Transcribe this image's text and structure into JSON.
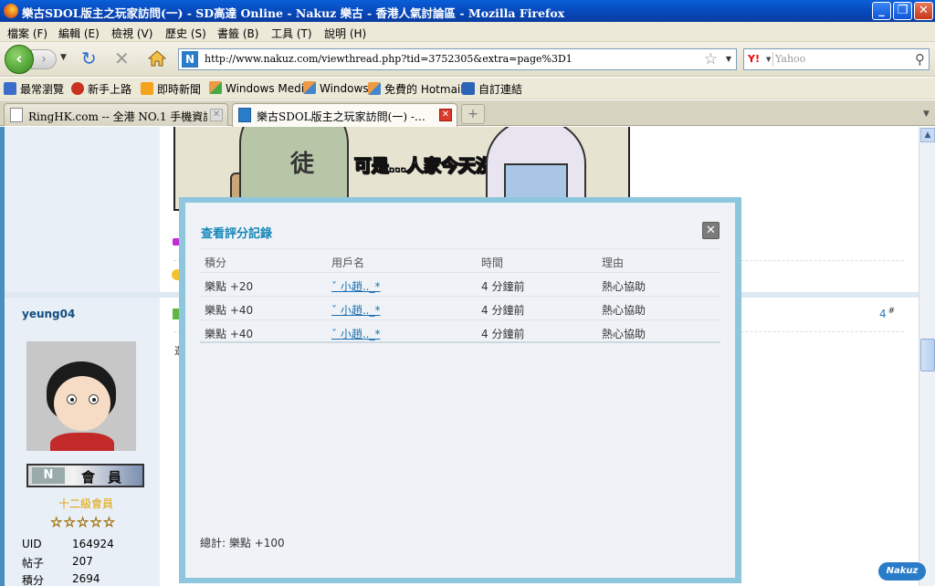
{
  "window": {
    "title": "樂古SDOL版主之玩家訪問(一) - SD高達 Online - Nakuz 樂古 - 香港人氣討論區 - Mozilla Firefox",
    "buttons": {
      "minimize": "_",
      "maximize": "❐",
      "close": "✕"
    }
  },
  "menu": [
    "檔案 (F)",
    "編輯 (E)",
    "檢視 (V)",
    "歷史 (S)",
    "書籤 (B)",
    "工具 (T)",
    "說明 (H)"
  ],
  "nav": {
    "url": "http://www.nakuz.com/viewthread.php?tid=3752305&extra=page%3D1",
    "search_placeholder": "Yahoo",
    "search_engine": "Y!"
  },
  "bookmarks": [
    "最常瀏覽",
    "新手上路",
    "即時新聞",
    "Windows Media",
    "Windows",
    "免費的 Hotmail",
    "自訂連結"
  ],
  "tabs": [
    {
      "label": "RingHK.com -- 全港 NO.1 手機資訊…",
      "active": false
    },
    {
      "label": "樂古SDOL版主之玩家訪問(一) -…",
      "active": true
    }
  ],
  "page": {
    "comic_caption": "可是…人家今天沒穿內褲..",
    "comic_glyph": "徒",
    "post": {
      "username": "yeung04",
      "badge_label": "會員",
      "rank": "十二級會員",
      "stars": "☆☆☆☆☆",
      "stats": [
        {
          "label": "UID",
          "value": "164924"
        },
        {
          "label": "帖子",
          "value": "207"
        },
        {
          "label": "積分",
          "value": "2694"
        }
      ],
      "post_number": "4",
      "post_suffix": "#",
      "body_start": "逛"
    },
    "logo": "Nakuz"
  },
  "modal": {
    "title": "查看評分記錄",
    "close": "✕",
    "columns": [
      "積分",
      "用戶名",
      "時間",
      "理由"
    ],
    "rows": [
      {
        "score": "樂點 +20",
        "user": "ˇ 小趙.._*",
        "time": "4 分鐘前",
        "reason": "熱心協助"
      },
      {
        "score": "樂點 +40",
        "user": "ˇ 小趙.._*",
        "time": "4 分鐘前",
        "reason": "熱心協助"
      },
      {
        "score": "樂點 +40",
        "user": "ˇ 小趙.._*",
        "time": "4 分鐘前",
        "reason": "熱心協助"
      }
    ],
    "total": "總計: 樂點 +100"
  },
  "colors": {
    "accent": "#1686b8",
    "modal_border": "#8ec6dd",
    "link": "#1a6fb0"
  }
}
